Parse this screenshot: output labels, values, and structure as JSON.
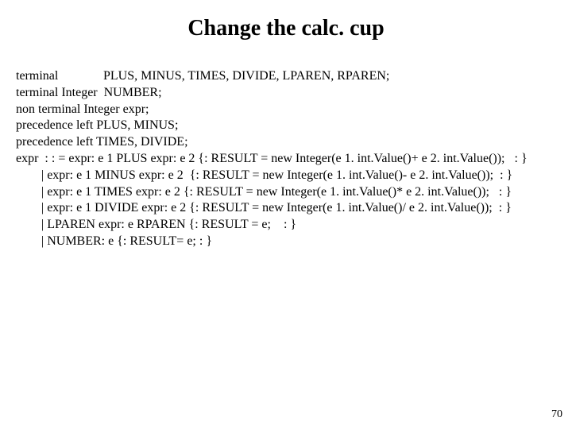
{
  "title": "Change the calc. cup",
  "lines": {
    "l0a": "terminal",
    "l0b": "PLUS, MINUS, TIMES, DIVIDE, LPAREN, RPAREN;",
    "l1": "terminal Integer  NUMBER;",
    "l2": "non terminal Integer expr;",
    "l3": "precedence left PLUS, MINUS;",
    "l4": "precedence left TIMES, DIVIDE;",
    "l5": "expr  : : = expr: e 1 PLUS expr: e 2 {: RESULT = new Integer(e 1. int.Value()+ e 2. int.Value());   : }",
    "l6": "        | expr: e 1 MINUS expr: e 2  {: RESULT = new Integer(e 1. int.Value()- e 2. int.Value());  : }",
    "l7": "        | expr: e 1 TIMES expr: e 2 {: RESULT = new Integer(e 1. int.Value()* e 2. int.Value());   : }",
    "l8": "        | expr: e 1 DIVIDE expr: e 2 {: RESULT = new Integer(e 1. int.Value()/ e 2. int.Value());  : }",
    "l9": "        | LPAREN expr: e RPAREN {: RESULT = e;    : }",
    "l10": "        | NUMBER: e {: RESULT= e; : }"
  },
  "page_number": "70"
}
